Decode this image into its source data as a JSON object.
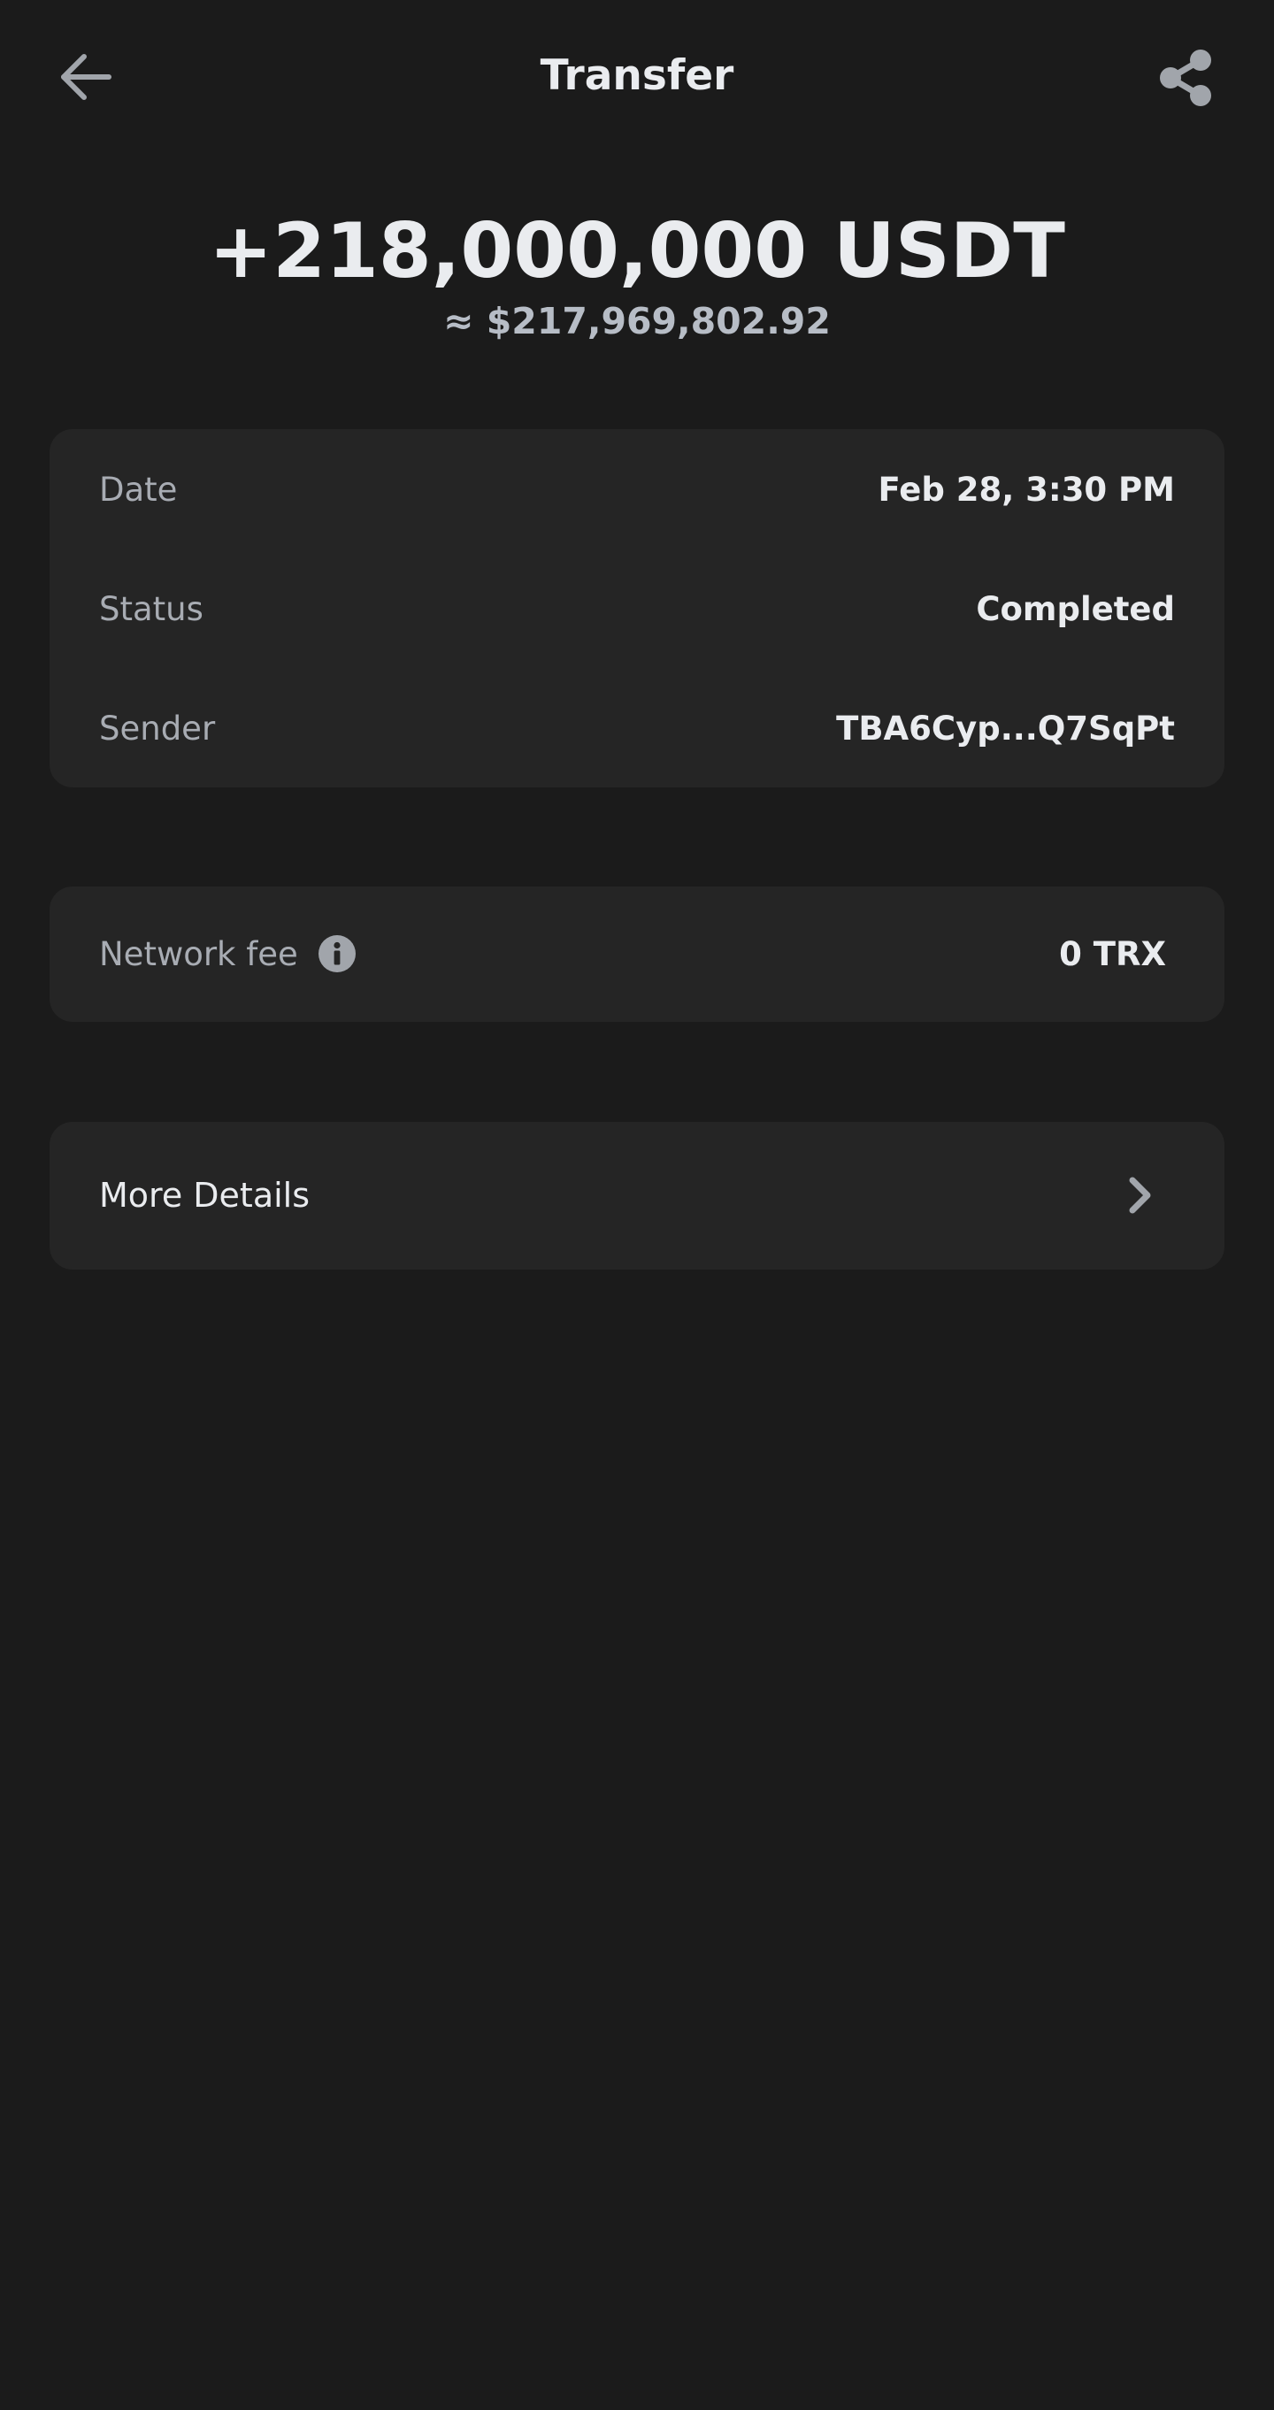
{
  "header": {
    "title": "Transfer",
    "back_icon": "arrow-left-icon",
    "share_icon": "share-icon"
  },
  "summary": {
    "amount": "+218,000,000 USDT",
    "fiat_value": "≈ $217,969,802.92"
  },
  "details": {
    "rows": [
      {
        "label": "Date",
        "value": "Feb 28, 3:30 PM"
      },
      {
        "label": "Status",
        "value": "Completed"
      },
      {
        "label": "Sender",
        "value": "TBA6Cyp...Q7SqPt"
      }
    ]
  },
  "fee": {
    "label": "Network fee",
    "value": "0 TRX",
    "info_icon": "info-icon"
  },
  "more": {
    "label": "More Details",
    "chevron_icon": "chevron-right-icon"
  },
  "colors": {
    "background": "#1b1b1b",
    "card": "#252525",
    "primary_text": "#eaecef",
    "secondary_text": "#a8acb3",
    "icon": "#a1a5ab"
  }
}
